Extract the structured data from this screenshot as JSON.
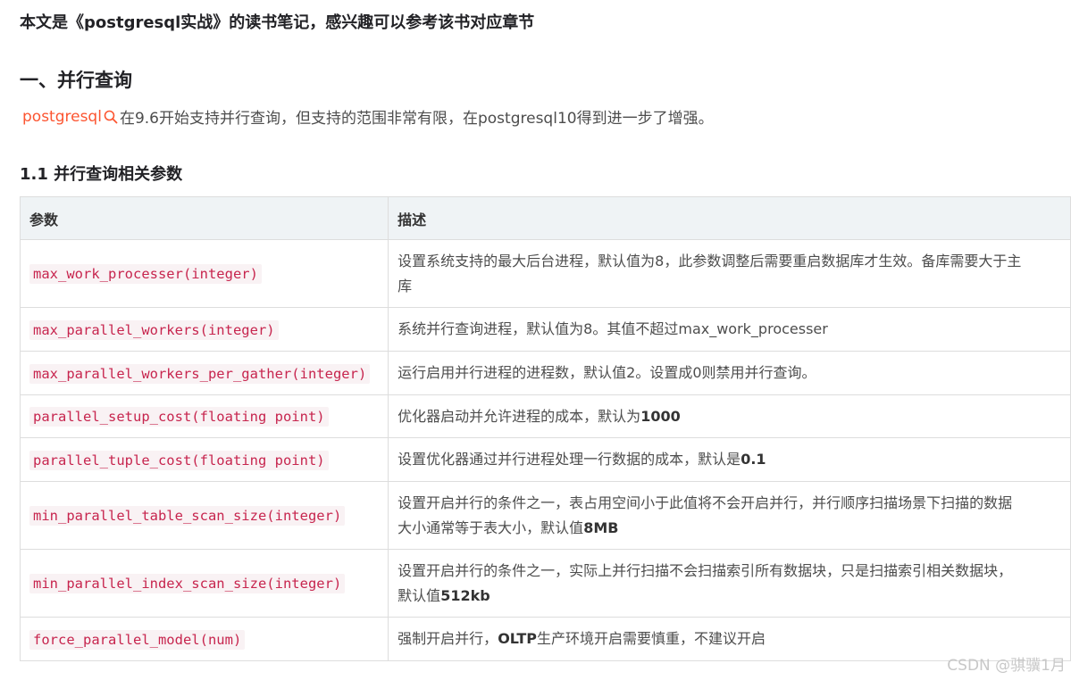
{
  "intro": "本文是《postgresql实战》的读书笔记，感兴趣可以参考该书对应章节",
  "section1": {
    "title": "一、并行查询",
    "keyword_link": "postgresql",
    "paragraph": "在9.6开始支持并行查询，但支持的范围非常有限，在postgresql10得到进一步了增强。"
  },
  "subsection": {
    "title": "1.1 并行查询相关参数"
  },
  "table": {
    "headers": [
      "参数",
      "描述"
    ],
    "rows": [
      {
        "param": "max_work_processer(integer)",
        "desc_lines": [
          "设置系统支持的最大后台进程，默认值为8，此参数调整后需要重启数据库才生效。备库需要大于主",
          "库"
        ]
      },
      {
        "param": "max_parallel_workers(integer)",
        "desc_lines": [
          "系统并行查询进程，默认值为8。其值不超过max_work_processer"
        ]
      },
      {
        "param": "max_parallel_workers_per_gather(integer)",
        "desc_lines": [
          "运行启用并行进程的进程数，默认值2。设置成0则禁用并行查询。"
        ]
      },
      {
        "param": "parallel_setup_cost(floating point)",
        "desc_prefix": "优化器启动并允许进程的成本，默认为",
        "desc_bold": "1000"
      },
      {
        "param": "parallel_tuple_cost(floating point)",
        "desc_prefix": "设置优化器通过并行进程处理一行数据的成本，默认是",
        "desc_bold": "0.1"
      },
      {
        "param": "min_parallel_table_scan_size(integer)",
        "desc_line1": "设置开启并行的条件之一，表占用空间小于此值将不会开启并行，并行顺序扫描场景下扫描的数据",
        "desc_prefix": "大小通常等于表大小，默认值",
        "desc_bold": "8MB"
      },
      {
        "param": "min_parallel_index_scan_size(integer)",
        "desc_line1": "设置开启并行的条件之一，实际上并行扫描不会扫描索引所有数据块，只是扫描索引相关数据块，",
        "desc_prefix": "默认值",
        "desc_bold": "512kb"
      },
      {
        "param": "force_parallel_model(num)",
        "desc_prefix": "强制开启并行，",
        "desc_bold": "OLTP",
        "desc_suffix": "生产环境开启需要慎重，不建议开启"
      }
    ]
  },
  "watermark": "CSDN @骐骥1月",
  "colors": {
    "link": "#fc5531",
    "code_text": "#c7254e",
    "code_bg": "#f9f2f4",
    "header_bg": "#eff3f5",
    "border": "#dddddd"
  },
  "icons": {
    "keyword_search": "search-icon"
  }
}
